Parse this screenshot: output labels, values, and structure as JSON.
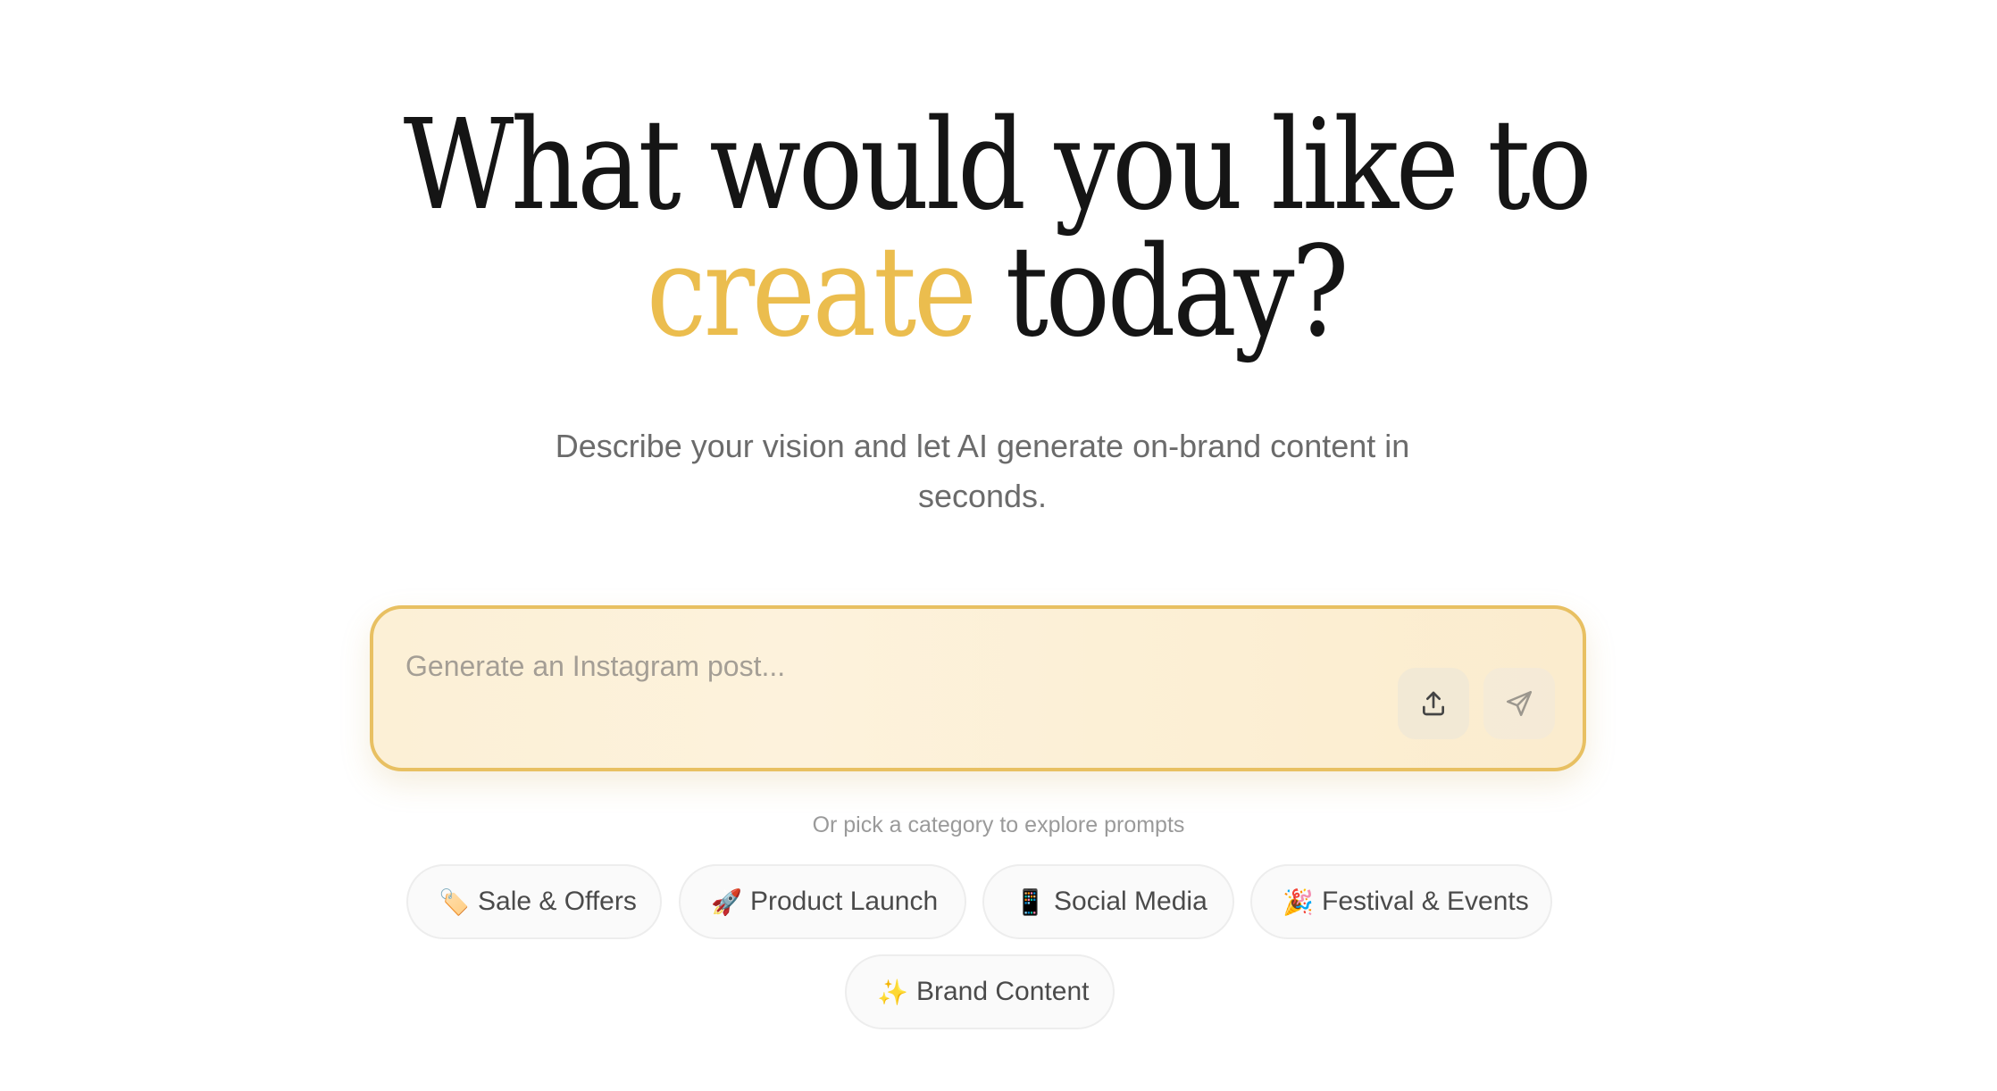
{
  "headline": {
    "line1": "What would you like to",
    "accent_word": "create",
    "line2_rest": "today?",
    "accent_color": "#ebbd4e"
  },
  "subtitle": "Describe your vision and let AI generate on-brand content in seconds.",
  "prompt": {
    "placeholder": "Generate an Instagram post...",
    "value": "",
    "upload_icon": "upload-icon",
    "send_icon": "send-icon",
    "border_color": "#e8c062"
  },
  "pick_hint": "Or pick a category to explore prompts",
  "categories": [
    {
      "emoji": "🏷️",
      "label": "Sale & Offers"
    },
    {
      "emoji": "🚀",
      "label": "Product Launch"
    },
    {
      "emoji": "📱",
      "label": "Social Media"
    },
    {
      "emoji": "🎉",
      "label": "Festival & Events"
    },
    {
      "emoji": "✨",
      "label": "Brand Content"
    }
  ]
}
